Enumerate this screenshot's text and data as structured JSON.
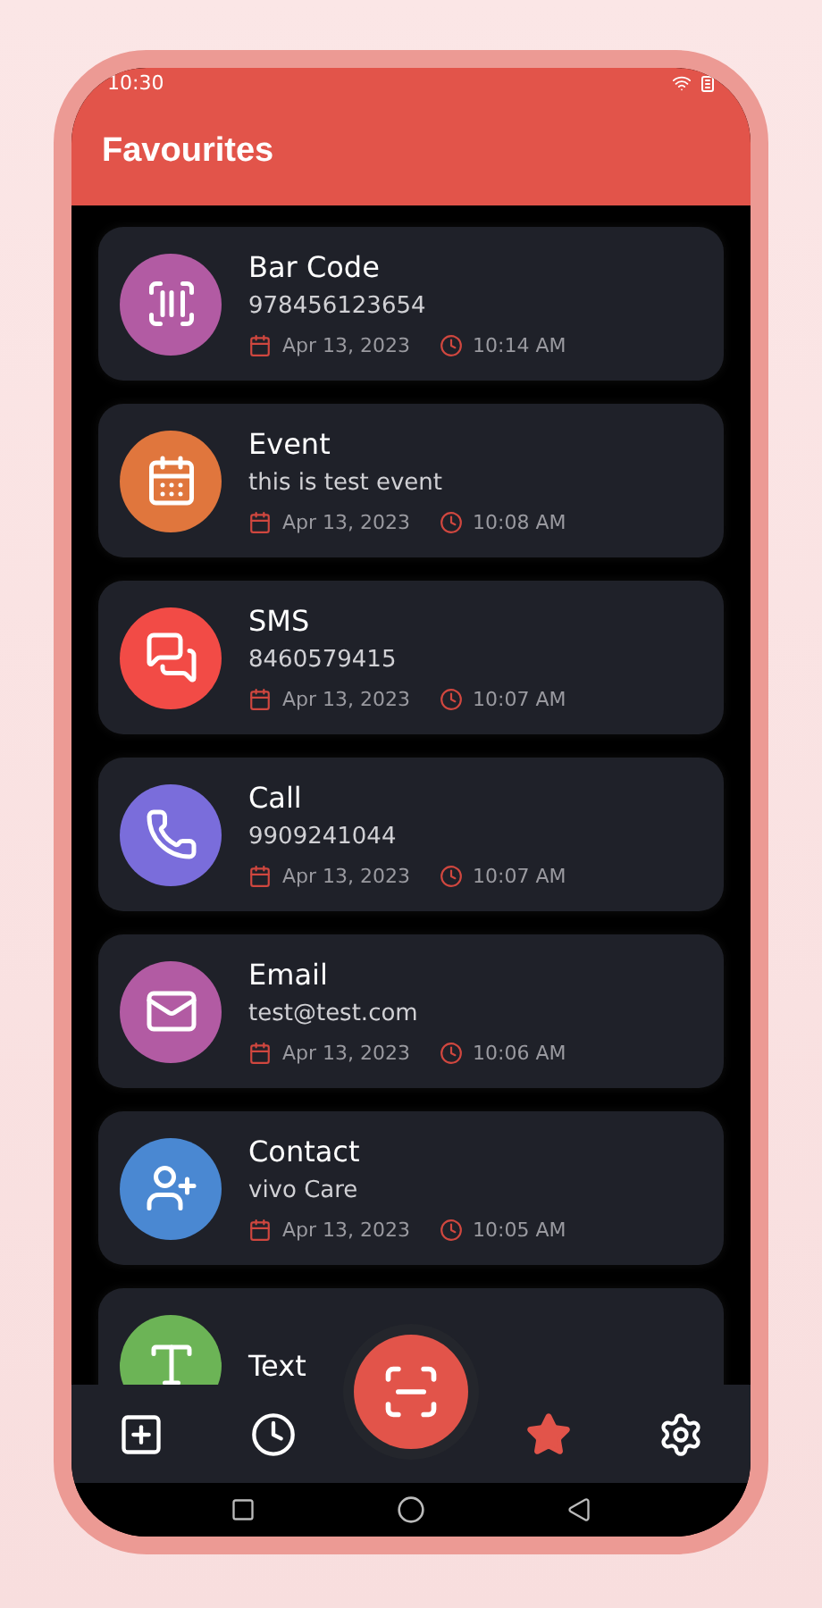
{
  "status_bar": {
    "time": "10:30"
  },
  "header": {
    "title": "Favourites"
  },
  "items": [
    {
      "kind": "barcode",
      "title": "Bar Code",
      "detail": "978456123654",
      "date": "Apr 13, 2023",
      "time": "10:14 AM",
      "color": "#b25ba3"
    },
    {
      "kind": "event",
      "title": "Event",
      "detail": "this is test event",
      "date": "Apr 13, 2023",
      "time": "10:08 AM",
      "color": "#e0763d"
    },
    {
      "kind": "sms",
      "title": "SMS",
      "detail": "8460579415",
      "date": "Apr 13, 2023",
      "time": "10:07 AM",
      "color": "#f24b46"
    },
    {
      "kind": "call",
      "title": "Call",
      "detail": "9909241044",
      "date": "Apr 13, 2023",
      "time": "10:07 AM",
      "color": "#7a6ddb"
    },
    {
      "kind": "email",
      "title": "Email",
      "detail": "test@test.com",
      "date": "Apr 13, 2023",
      "time": "10:06 AM",
      "color": "#b25ba3"
    },
    {
      "kind": "contact",
      "title": "Contact",
      "detail": "vivo Care",
      "date": "Apr 13, 2023",
      "time": "10:05 AM",
      "color": "#4a88d2"
    },
    {
      "kind": "text",
      "title": "Text",
      "color": "#6cb456"
    }
  ],
  "nav": [
    {
      "kind": "create",
      "selected": false
    },
    {
      "kind": "history",
      "selected": false
    },
    {
      "kind": "favourites",
      "selected": true
    },
    {
      "kind": "settings",
      "selected": false
    }
  ]
}
